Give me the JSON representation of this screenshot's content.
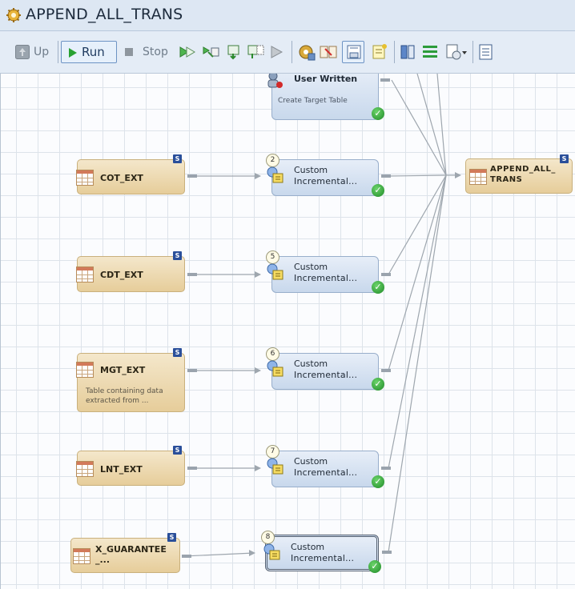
{
  "window": {
    "title": "APPEND_ALL_TRANS",
    "icon": "gear-icon"
  },
  "toolbar": {
    "up_label": "Up",
    "run_label": "Run",
    "stop_label": "Stop",
    "icons": [
      "run-from-selected-icon",
      "run-selected-icon",
      "step-icon",
      "continue-icon",
      "pause-icon",
      "job-properties-icon",
      "mapping-icon",
      "save-icon",
      "add-note-icon",
      "layout-icon",
      "align-icon",
      "dropdown-tool-icon",
      "details-icon"
    ]
  },
  "tables": [
    {
      "name": "COT_EXT",
      "description": ""
    },
    {
      "name": "CDT_EXT",
      "description": ""
    },
    {
      "name": "MGT_EXT",
      "description": "Table containing data extracted from ..."
    },
    {
      "name": "LNT_EXT",
      "description": ""
    },
    {
      "name": "X_GUARANTEE_...",
      "name_line1": "X_GUARANTEE",
      "name_line2": "_...",
      "description": ""
    }
  ],
  "transforms": [
    {
      "number": "",
      "line1": "User Written",
      "line2": "",
      "description": "Create Target Table",
      "status": "complete"
    },
    {
      "number": "2",
      "line1": "Custom",
      "line2": "Incremental...",
      "description": "",
      "status": "complete"
    },
    {
      "number": "5",
      "line1": "Custom",
      "line2": "Incremental...",
      "description": "",
      "status": "complete"
    },
    {
      "number": "6",
      "line1": "Custom",
      "line2": "Incremental...",
      "description": "",
      "status": "complete"
    },
    {
      "number": "7",
      "line1": "Custom",
      "line2": "Incremental...",
      "description": "",
      "status": "complete"
    },
    {
      "number": "8",
      "line1": "Custom",
      "line2": "Incremental...",
      "description": "",
      "status": "complete"
    }
  ],
  "target": {
    "name": "APPEND_ALL_TRANS",
    "line1": "APPEND_ALL_",
    "line2": "TRANS",
    "badge": "S"
  },
  "badge_letter": "S",
  "colors": {
    "table_node": "#e8d2a2",
    "transform_node": "#cddcef",
    "status_ok": "#2b9b32",
    "canvas_grid": "#dde3ea"
  }
}
